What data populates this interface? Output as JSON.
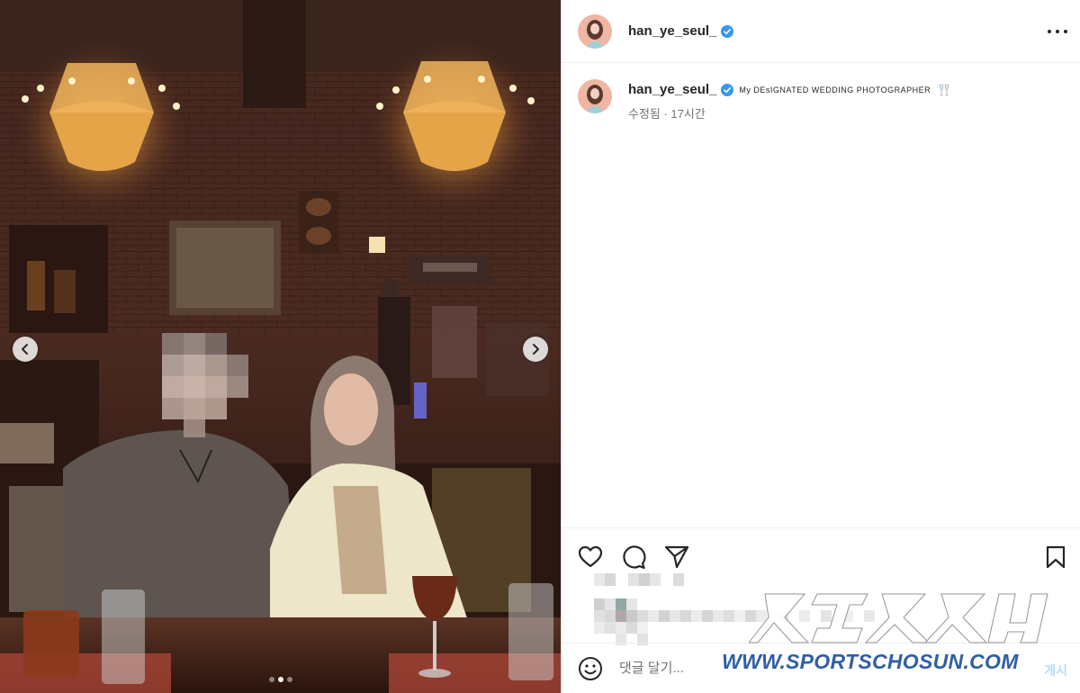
{
  "post": {
    "username": "han_ye_seul_",
    "verified": true,
    "caption_text": "My DEsIGNATED WEDDING PHOTOGRAPHER",
    "caption_emoji": "champagne-glasses-icon",
    "caption_meta": "수정됨 · 17시간",
    "carousel": {
      "total_slides": 3,
      "current_slide": 2
    }
  },
  "comment": {
    "placeholder": "댓글 달기...",
    "post_label": "게시"
  },
  "watermark": {
    "url": "WWW.SPORTSCHOSUN.COM"
  },
  "colors": {
    "verified_blue": "#3897f0",
    "post_button": "#b2dffc",
    "watermark_blue": "#2f5fa6"
  }
}
